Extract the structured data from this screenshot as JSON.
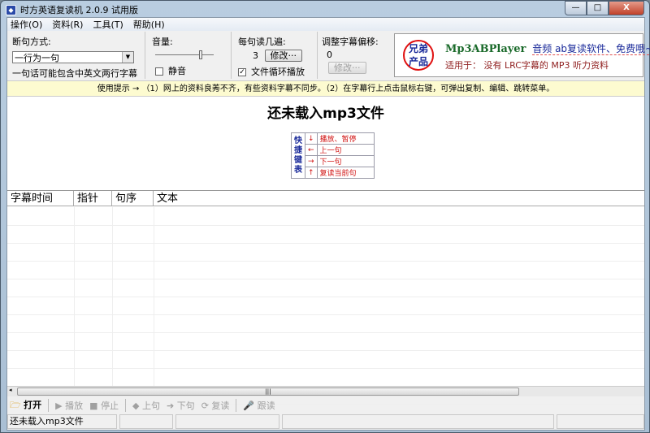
{
  "window": {
    "title": "时方英语复读机 2.0.9 试用版",
    "min": "—",
    "max": "□",
    "close": "X"
  },
  "menu": [
    "操作(O)",
    "资料(R)",
    "工具(T)",
    "帮助(H)"
  ],
  "split": {
    "label": "断句方式:",
    "value": "一行为一句",
    "note": "一句话可能包含中英文两行字幕"
  },
  "volume": {
    "label": "音量:",
    "mute": "静音",
    "level": 0.85,
    "muted": false
  },
  "repeat": {
    "label": "每句读几遍:",
    "count": "3",
    "modify": "修改···",
    "loop": "文件循环播放",
    "loop_checked": true
  },
  "offset": {
    "label": "调整字幕偏移:",
    "value": "0",
    "modify": "修改···"
  },
  "ad": {
    "seal": [
      "兄弟",
      "产品"
    ],
    "name": "Mp3ABPlayer",
    "slogan": "音频 ab复读软件、免费哦~",
    "line2": "适用于：  没有 LRC字幕的 MP3 听力资料"
  },
  "tip": "使用提示 → （1）网上的资料良莠不齐，有些资料字幕不同步。（2）在字幕行上点击鼠标右键，可弹出复制、编辑、跳转菜单。",
  "main_title": "还未载入mp3文件",
  "shortcuts": {
    "header": [
      "快",
      "捷",
      "键",
      "表"
    ],
    "rows": [
      {
        "key": "↓",
        "action": "播放、暂停"
      },
      {
        "key": "←",
        "action": "上一句"
      },
      {
        "key": "→",
        "action": "下一句"
      },
      {
        "key": "↑",
        "action": "复读当前句"
      }
    ]
  },
  "columns": [
    "字幕时间",
    "指针",
    "句序",
    "文本"
  ],
  "toolbar": {
    "open": "打开",
    "play": "播放",
    "stop": "停止",
    "prev": "上句",
    "next": "下句",
    "repeat": "复读",
    "follow": "跟读"
  },
  "status": "还未载入mp3文件"
}
